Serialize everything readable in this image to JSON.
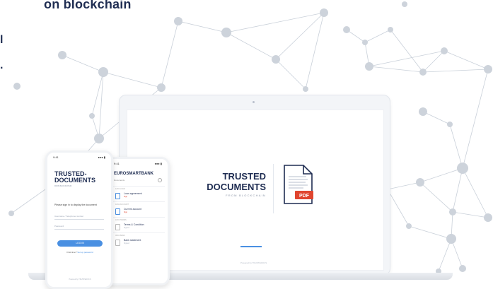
{
  "headline": "on blockchain",
  "side_glyphs": [
    "l",
    "."
  ],
  "laptop": {
    "title_line1": "TRUSTED",
    "title_line2": "DOCUMENTS",
    "subtitle": "FROM BLOCKCHAIN",
    "pdf_badge": "PDF",
    "footer": "Powered by  TRUSTEDOCS"
  },
  "phone_login": {
    "time": "9:41",
    "signal": "●●● ▮",
    "title_line1": "TRUSTED-",
    "title_line2": "DOCUMENTS",
    "subtitle": "FROM BLOCKCHAIN",
    "instruction": "Please sign in to display the document",
    "username_placeholder": "Username / Telephone number",
    "password_placeholder": "Password",
    "login_button": "LOG IN",
    "forgot_text": "First time?",
    "forgot_link": "Set up password",
    "footer": "Powered by TRUSTEDOCS"
  },
  "phone_bank": {
    "time": "9:41",
    "signal": "●●● ▮",
    "bank_name": "EUROSMARTBANK",
    "section": "Documents",
    "documents": [
      {
        "date": "12/04  LOAN",
        "name": "Loan agreement",
        "status": "Sign"
      },
      {
        "date": "11/04  ACCOUNT",
        "name": "Current account",
        "status": "Sign"
      },
      {
        "date": "10/04  TERMS",
        "name": "Terms & Condition",
        "status": "Signed"
      },
      {
        "date": "09/04  BANK",
        "name": "Bank statement",
        "status": "Signed"
      }
    ]
  },
  "colors": {
    "brand_navy": "#1f2d52",
    "accent_blue": "#4a90e2",
    "pdf_red": "#e0452f",
    "network_grey": "#c9d0d9"
  }
}
